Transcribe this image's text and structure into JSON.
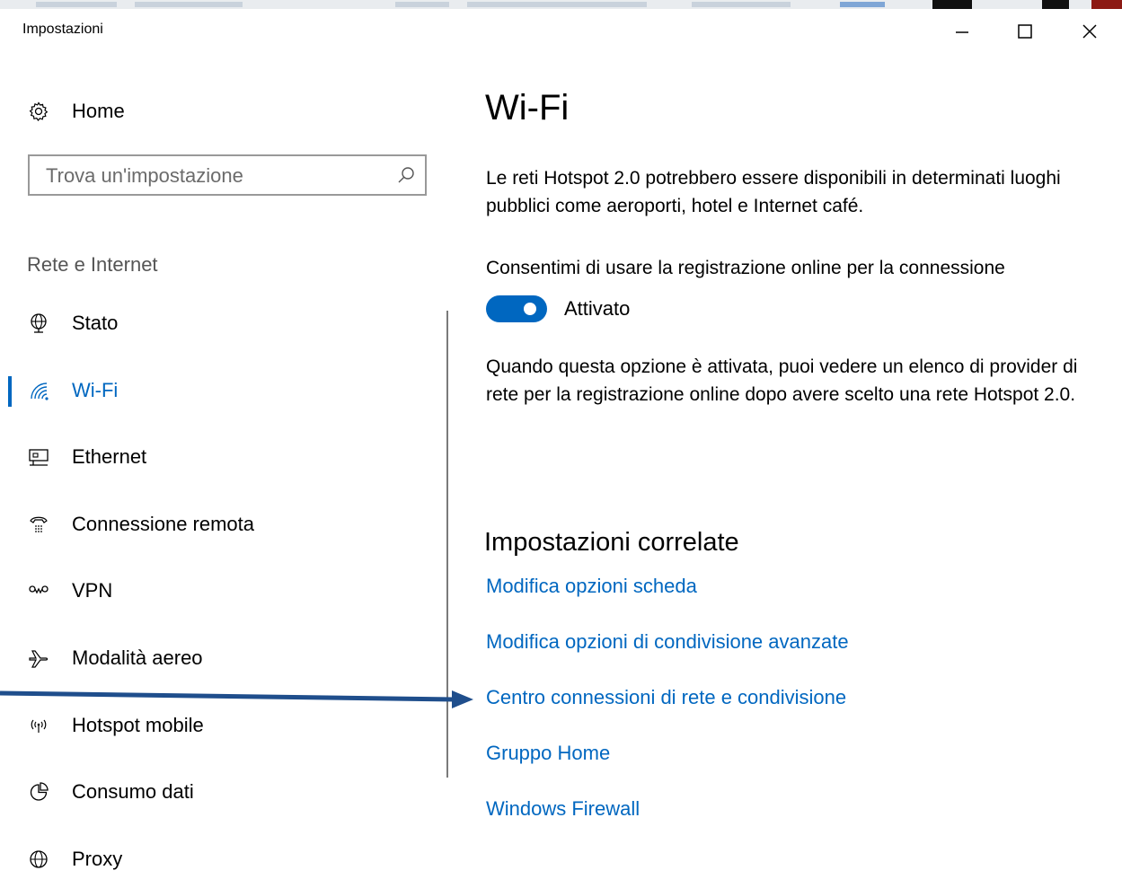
{
  "window": {
    "title": "Impostazioni"
  },
  "sidebar": {
    "home_label": "Home",
    "search": {
      "placeholder": "Trova un'impostazione",
      "value": ""
    },
    "section_label": "Rete e Internet",
    "items": [
      {
        "label": "Stato",
        "icon": "globe-network-icon",
        "active": false
      },
      {
        "label": "Wi-Fi",
        "icon": "wifi-icon",
        "active": true
      },
      {
        "label": "Ethernet",
        "icon": "ethernet-icon",
        "active": false
      },
      {
        "label": "Connessione remota",
        "icon": "dialup-icon",
        "active": false
      },
      {
        "label": "VPN",
        "icon": "vpn-icon",
        "active": false
      },
      {
        "label": "Modalità aereo",
        "icon": "airplane-icon",
        "active": false
      },
      {
        "label": "Hotspot mobile",
        "icon": "hotspot-icon",
        "active": false
      },
      {
        "label": "Consumo dati",
        "icon": "data-usage-icon",
        "active": false
      },
      {
        "label": "Proxy",
        "icon": "globe-icon",
        "active": false
      }
    ]
  },
  "main": {
    "title": "Wi-Fi",
    "hotspot_info": "Le reti Hotspot 2.0 potrebbero essere disponibili in determinati luoghi pubblici come aeroporti, hotel e Internet café.",
    "online_signup_label": "Consentimi di usare la registrazione online per la connessione",
    "toggle": {
      "state": "on",
      "label": "Attivato"
    },
    "online_signup_info": "Quando questa opzione è attivata, puoi vedere un elenco di provider di rete per la registrazione online dopo avere scelto una rete Hotspot 2.0.",
    "related_title": "Impostazioni correlate",
    "related_links": [
      "Modifica opzioni scheda",
      "Modifica opzioni di condivisione avanzate",
      "Centro connessioni di rete e condivisione",
      "Gruppo Home",
      "Windows Firewall"
    ]
  },
  "colors": {
    "accent": "#0067c0",
    "annotation_arrow": "#1f4e8c"
  }
}
